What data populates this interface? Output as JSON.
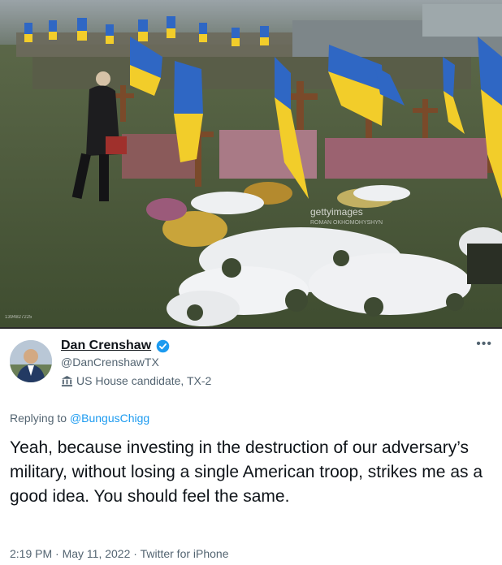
{
  "photo": {
    "watermark": "gettyimages",
    "credit": "ROMAN OKHOMOHYSHYN",
    "corner_tag": "1394827225",
    "colors": {
      "grass": "#4d5c3a",
      "snow": "#f2f3f5",
      "flag_blue": "#2f67c4",
      "flag_yellow": "#f2cd2a",
      "wood": "#7a4a2a"
    }
  },
  "tweet": {
    "display_name": "Dan Crenshaw",
    "handle": "@DanCrenshawTX",
    "label": "US House candidate, TX-2",
    "more_icon": "ellipsis-icon",
    "replying_prefix": "Replying to",
    "replying_to": "@BungusChigg",
    "text": "Yeah, because investing in the destruction of our adversary’s military, without losing a single American troop, strikes me as a good idea. You should feel the same.",
    "meta": "2:19 PM · May 11, 2022 · Twitter for iPhone",
    "colors": {
      "link": "#1d9bf0",
      "muted": "#536471",
      "text": "#0f1419"
    }
  }
}
